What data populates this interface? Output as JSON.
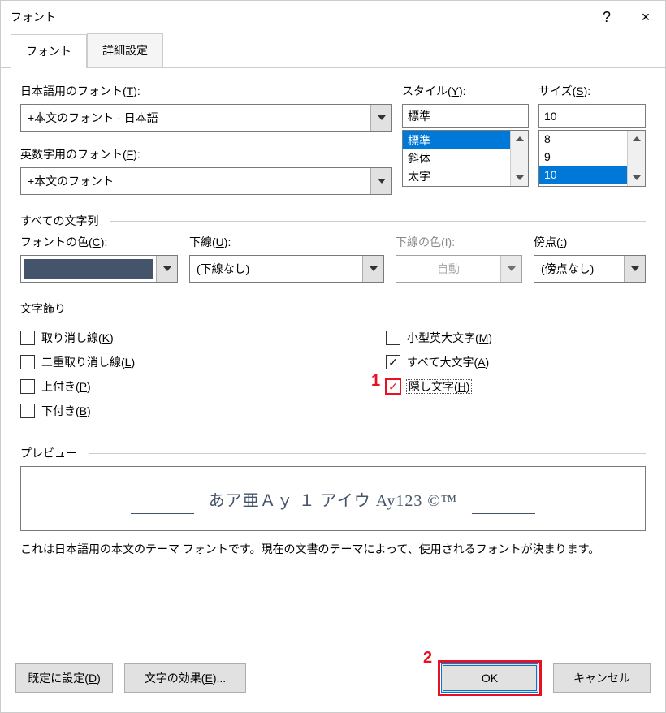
{
  "titlebar": {
    "title": "フォント",
    "help": "?",
    "close": "×"
  },
  "tabs": {
    "font": "フォント",
    "advanced": "詳細設定"
  },
  "labels": {
    "ja_font_pre": "日本語用のフォント(",
    "ja_font_key": "T",
    "ja_font_post": "):",
    "en_font_pre": "英数字用のフォント(",
    "en_font_key": "F",
    "en_font_post": "):",
    "style_pre": "スタイル(",
    "style_key": "Y",
    "style_post": "):",
    "size_pre": "サイズ(",
    "size_key": "S",
    "size_post": "):",
    "section_all": "すべての文字列",
    "font_color_pre": "フォントの色(",
    "font_color_key": "C",
    "font_color_post": "):",
    "underline_pre": "下線(",
    "underline_key": "U",
    "underline_post": "):",
    "underline_color": "下線の色(I):",
    "emphasis_pre": "傍点(",
    "emphasis_key": ":",
    "emphasis_post": ")",
    "section_effects": "文字飾り",
    "section_preview": "プレビュー"
  },
  "fonts": {
    "ja_value": "+本文のフォント - 日本語",
    "en_value": "+本文のフォント"
  },
  "style": {
    "value": "標準",
    "options": [
      "標準",
      "斜体",
      "太字"
    ],
    "selected_index": 0
  },
  "size": {
    "value": "10",
    "options": [
      "8",
      "9",
      "10"
    ],
    "selected_index": 2
  },
  "underline": {
    "value": "(下線なし)"
  },
  "underline_color": {
    "value": "自動"
  },
  "emphasis": {
    "value": "(傍点なし)"
  },
  "effects": {
    "strike_pre": "取り消し線(",
    "strike_key": "K",
    "strike_post": ")",
    "dstrike_pre": "二重取り消し線(",
    "dstrike_key": "L",
    "dstrike_post": ")",
    "super_pre": "上付き(",
    "super_key": "P",
    "super_post": ")",
    "sub_pre": "下付き(",
    "sub_key": "B",
    "sub_post": ")",
    "smallcaps_pre": "小型英大文字(",
    "smallcaps_key": "M",
    "smallcaps_post": ")",
    "allcaps_pre": "すべて大文字(",
    "allcaps_key": "A",
    "allcaps_post": ")",
    "hidden_pre": "隠し文字(",
    "hidden_key": "H",
    "hidden_post": ")"
  },
  "preview": {
    "text": "あア亜Ａｙ １ アイウ Ay123 ©™",
    "desc": "これは日本語用の本文のテーマ フォントです。現在の文書のテーマによって、使用されるフォントが決まります。"
  },
  "footer": {
    "default_pre": "既定に設定(",
    "default_key": "D",
    "default_post": ")",
    "text_eff_pre": "文字の効果(",
    "text_eff_key": "E",
    "text_eff_post": ")...",
    "ok": "OK",
    "cancel": "キャンセル"
  },
  "annotations": {
    "one": "1",
    "two": "2"
  }
}
